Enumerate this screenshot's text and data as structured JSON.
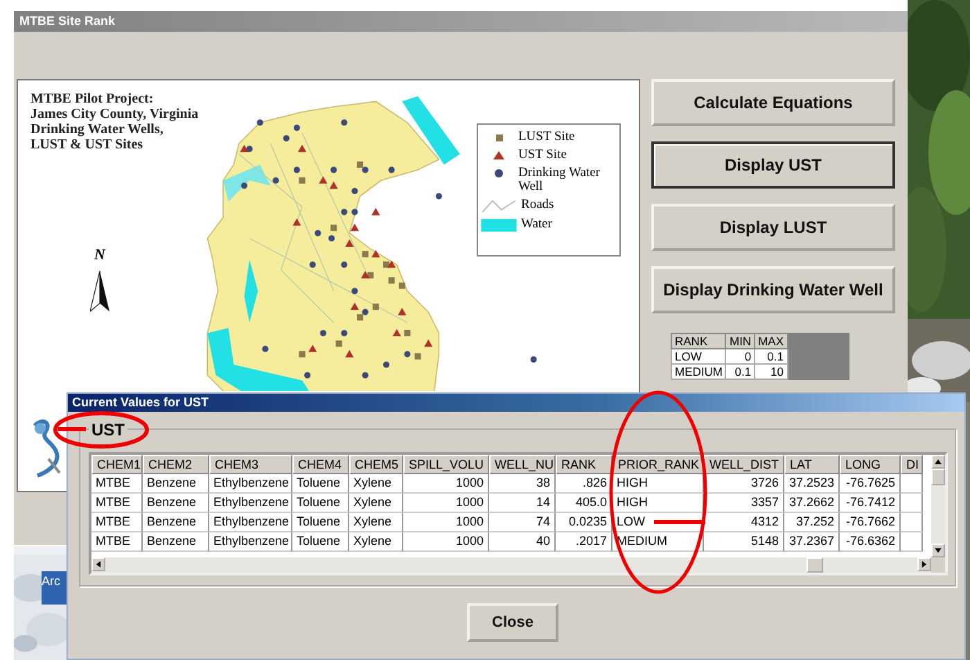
{
  "window": {
    "title": "MTBE Site Rank"
  },
  "map": {
    "title_lines": [
      "MTBE Pilot Project:",
      "James City County, Virginia",
      "Drinking Water Wells,",
      "LUST & UST Sites"
    ],
    "north_label": "N",
    "legend": [
      {
        "kind": "square",
        "label": "LUST Site"
      },
      {
        "kind": "triangle",
        "label": "UST Site"
      },
      {
        "kind": "dot",
        "label": "Drinking Water Well"
      },
      {
        "kind": "road",
        "label": "Roads"
      },
      {
        "kind": "water",
        "label": "Water"
      }
    ]
  },
  "buttons": [
    {
      "label": "Calculate Equations",
      "selected": false
    },
    {
      "label": "Display UST",
      "selected": true
    },
    {
      "label": "Display LUST",
      "selected": false
    },
    {
      "label": "Display Drinking Water Well",
      "selected": false
    }
  ],
  "rank_table": {
    "columns": [
      "RANK",
      "MIN",
      "MAX"
    ],
    "rows": [
      [
        "LOW",
        "0",
        "0.1"
      ],
      [
        "MEDIUM",
        "0.1",
        "10"
      ]
    ]
  },
  "desktop_icon": {
    "label": "Arc"
  },
  "dialog": {
    "title": "Current Values for UST",
    "group_label": "UST",
    "columns": [
      "CHEM1",
      "CHEM2",
      "CHEM3",
      "CHEM4",
      "CHEM5",
      "SPILL_VOLU",
      "WELL_NU",
      "RANK",
      "PRIOR_RANK",
      "WELL_DIST",
      "LAT",
      "LONG",
      "DI"
    ],
    "rows": [
      [
        "MTBE",
        "Benzene",
        "Ethylbenzene",
        "Toluene",
        "Xylene",
        "1000",
        "38",
        ".826",
        "HIGH",
        "3726",
        "37.2523",
        "-76.7625"
      ],
      [
        "MTBE",
        "Benzene",
        "Ethylbenzene",
        "Toluene",
        "Xylene",
        "1000",
        "14",
        "405.0",
        "HIGH",
        "3357",
        "37.2662",
        "-76.7412"
      ],
      [
        "MTBE",
        "Benzene",
        "Ethylbenzene",
        "Toluene",
        "Xylene",
        "1000",
        "74",
        "0.0235",
        "LOW",
        "4312",
        "37.252",
        "-76.7662"
      ],
      [
        "MTBE",
        "Benzene",
        "Ethylbenzene",
        "Toluene",
        "Xylene",
        "1000",
        "40",
        ".2017",
        "MEDIUM",
        "5148",
        "37.2367",
        "-76.6362"
      ]
    ],
    "close_button": "Close"
  }
}
